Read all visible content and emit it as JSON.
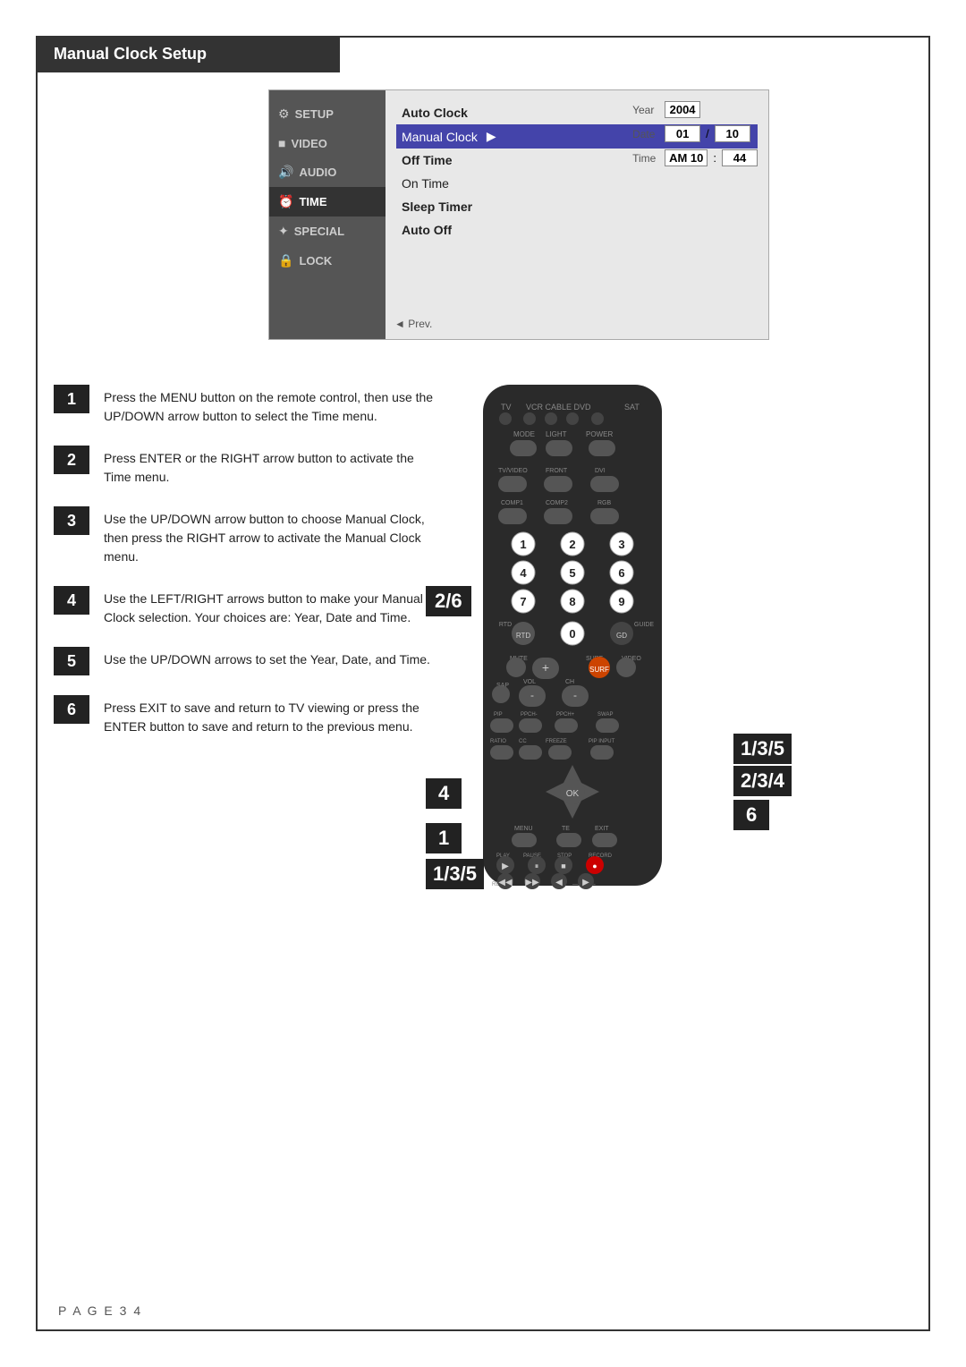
{
  "header": {
    "title": "Manual Clock Setup"
  },
  "menu": {
    "sidebar": [
      {
        "icon": "⚙",
        "label": "SETUP",
        "active": false
      },
      {
        "icon": "■",
        "label": "VIDEO",
        "active": false
      },
      {
        "icon": "🔊",
        "label": "AUDIO",
        "active": false
      },
      {
        "icon": "⏰",
        "label": "TIME",
        "active": true
      },
      {
        "icon": "✦",
        "label": "SPECIAL",
        "active": false
      },
      {
        "icon": "🔒",
        "label": "LOCK",
        "active": false
      }
    ],
    "items": [
      {
        "label": "Auto Clock",
        "bold": true,
        "selected": false
      },
      {
        "label": "Manual Clock",
        "bold": false,
        "selected": true,
        "arrow": "▶"
      },
      {
        "label": "Off Time",
        "bold": true,
        "selected": false
      },
      {
        "label": "On Time",
        "bold": false,
        "selected": false
      },
      {
        "label": "Sleep Timer",
        "bold": true,
        "selected": false
      },
      {
        "label": "Auto Off",
        "bold": true,
        "selected": false
      }
    ],
    "fields": {
      "year_label": "Year",
      "year_value": "2004",
      "date_label": "Date",
      "date_value1": "01",
      "date_sep": "/",
      "date_value2": "10",
      "time_label": "Time",
      "time_value1": "AM 10",
      "time_sep": ":",
      "time_value2": "44"
    },
    "prev": "◄ Prev."
  },
  "steps": [
    {
      "number": "1",
      "text": "Press the MENU button on the remote control, then use the UP/DOWN arrow button to select the Time menu."
    },
    {
      "number": "2",
      "text": "Press ENTER or the RIGHT arrow button to activate the Time menu."
    },
    {
      "number": "3",
      "text": "Use the UP/DOWN arrow button to choose Manual Clock, then press the RIGHT arrow to activate the Manual Clock menu."
    },
    {
      "number": "4",
      "text": "Use the LEFT/RIGHT arrows button to make your Manual Clock selection. Your choices are: Year, Date and Time."
    },
    {
      "number": "5",
      "text": "Use the UP/DOWN arrows to set the Year, Date, and Time."
    },
    {
      "number": "6",
      "text": "Press EXIT to save and return to TV viewing or press the ENTER button to save and return to the previous menu."
    }
  ],
  "step_labels": {
    "label_26": "2/6",
    "label_135_top": "1/3/5",
    "label_4": "4",
    "label_1": "1",
    "label_135_bot": "1/3/5",
    "label_135_right": "1/3/5",
    "label_234": "2/3/4",
    "label_6": "6"
  },
  "page": "P A G E   3 4"
}
